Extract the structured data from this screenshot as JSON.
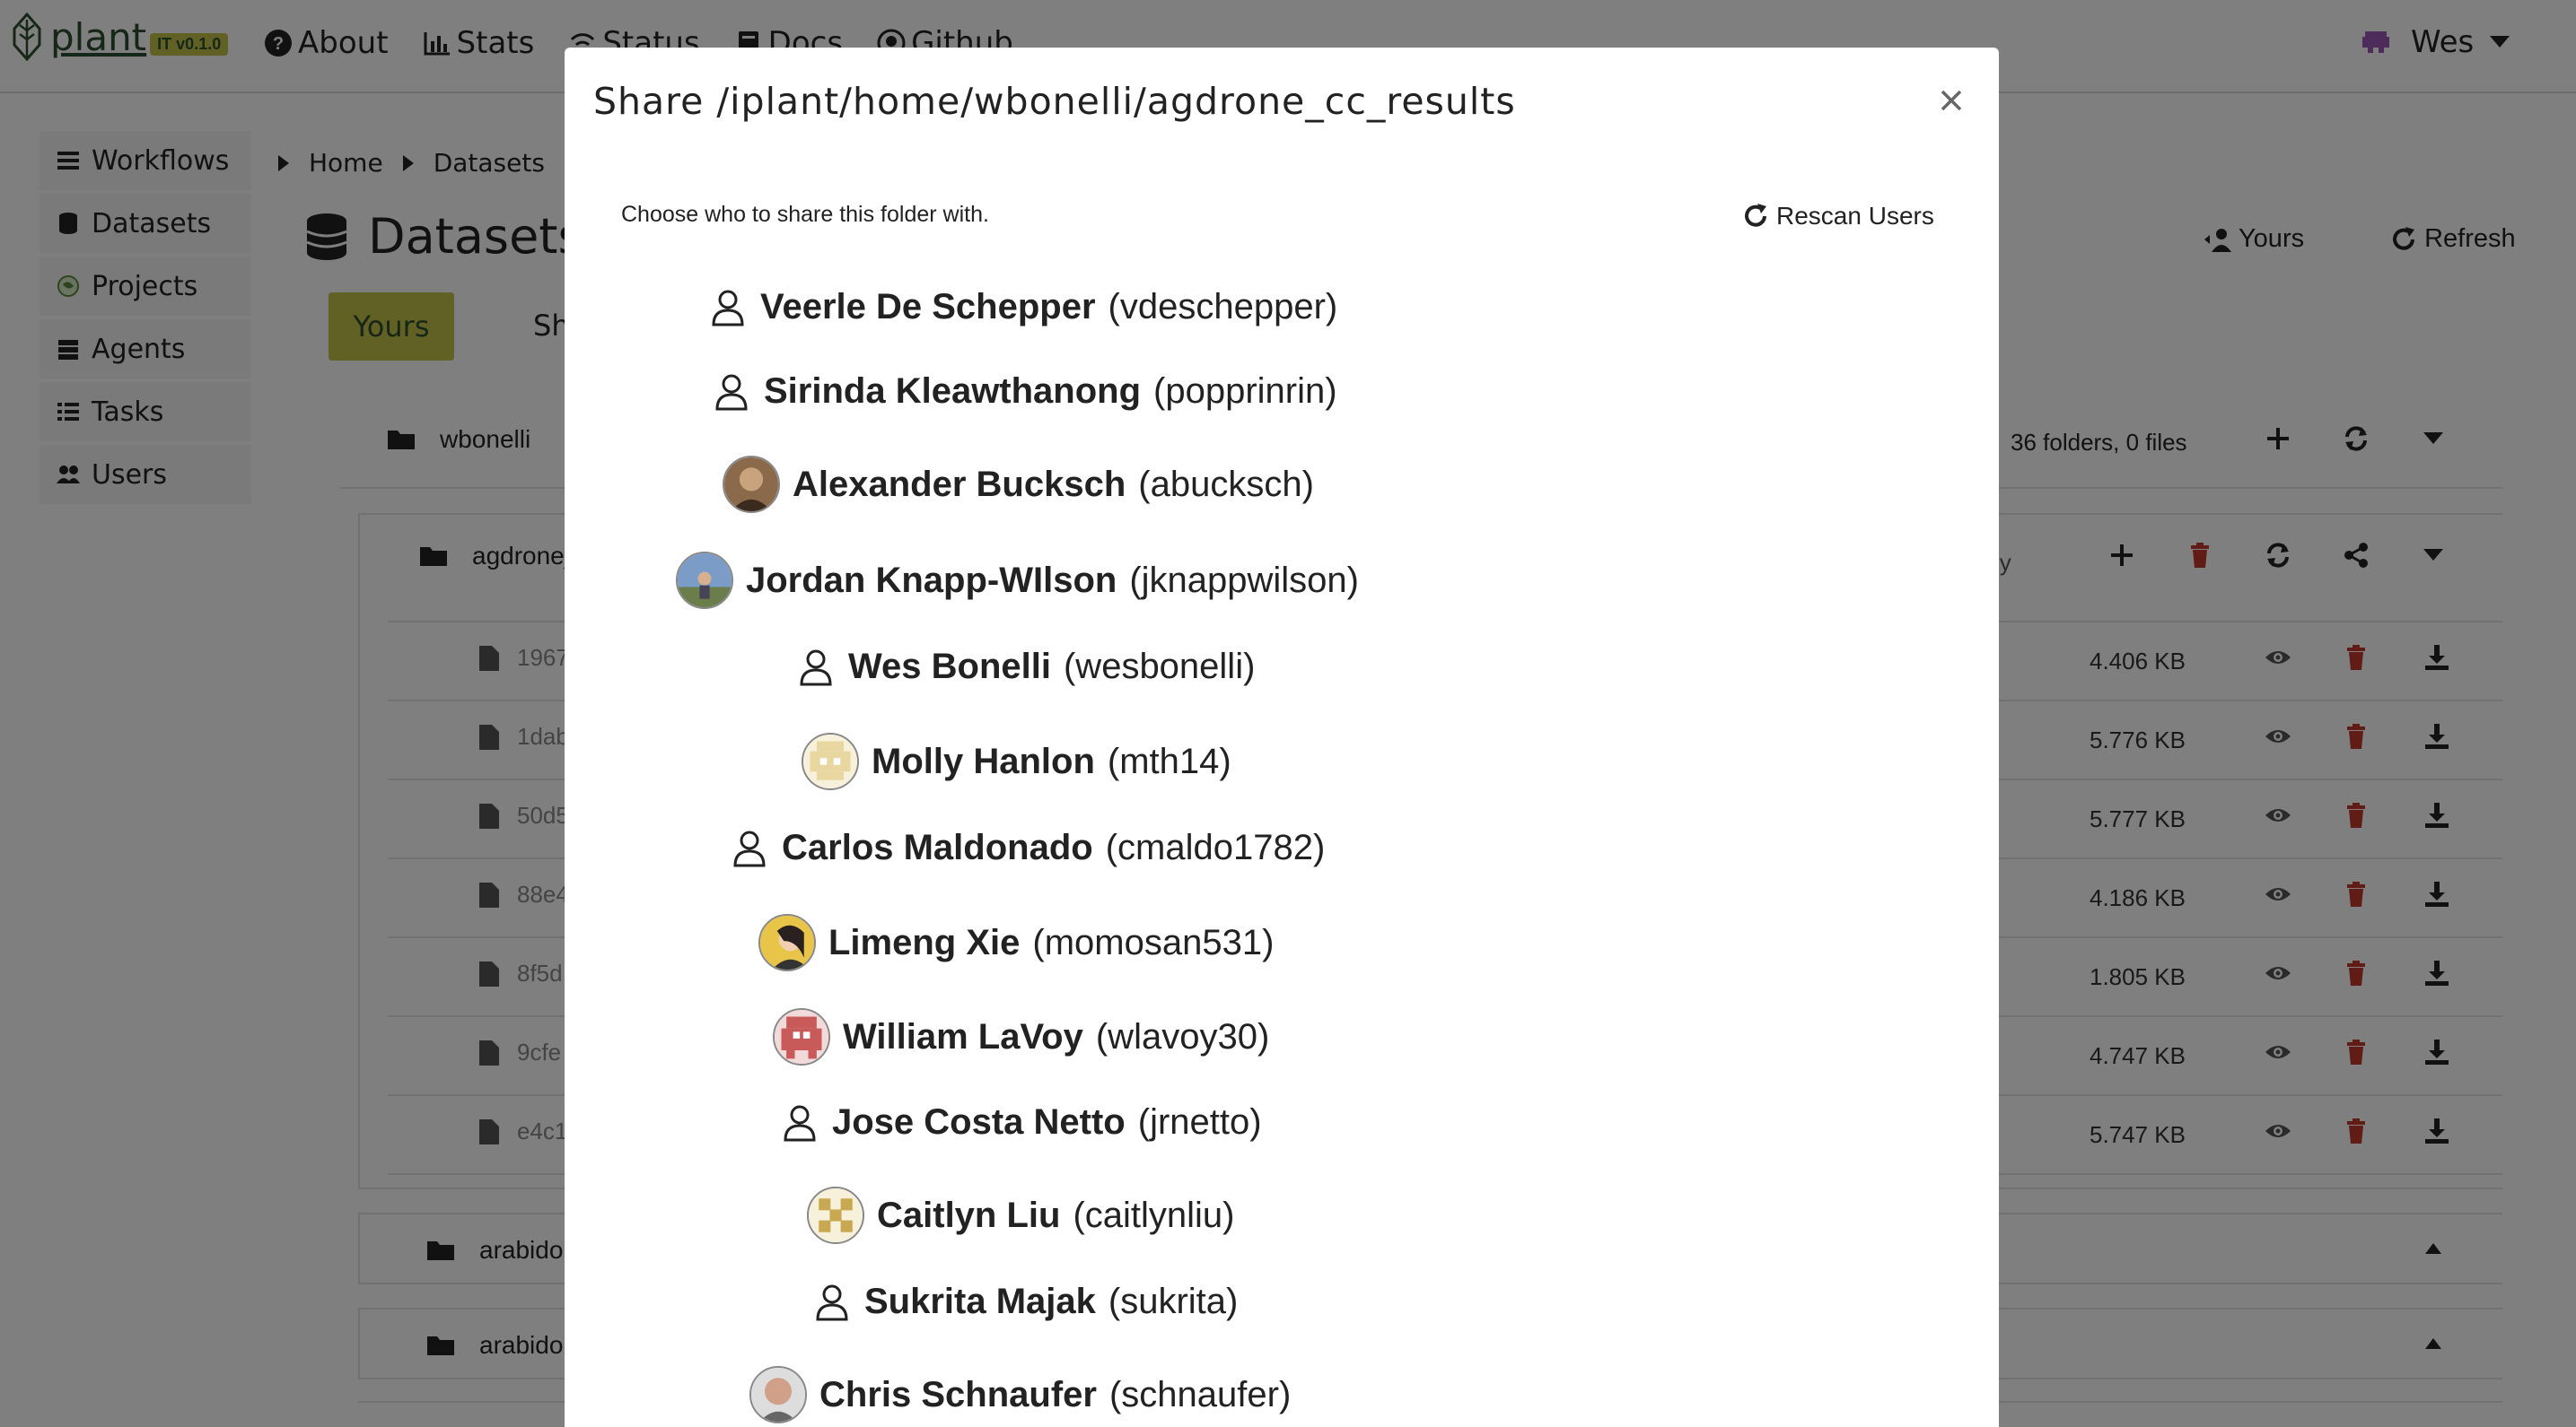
{
  "brand": {
    "name": "plant",
    "suffix": "IT",
    "version": "v0.1.0"
  },
  "nav": {
    "links": [
      "About",
      "Stats",
      "Status",
      "Docs",
      "Github"
    ],
    "user": "Wes"
  },
  "sidebar": {
    "items": [
      {
        "label": "Workflows",
        "icon": "list-icon"
      },
      {
        "label": "Datasets",
        "icon": "database-icon"
      },
      {
        "label": "Projects",
        "icon": "globe-icon"
      },
      {
        "label": "Agents",
        "icon": "server-icon"
      },
      {
        "label": "Tasks",
        "icon": "tasks-icon"
      },
      {
        "label": "Users",
        "icon": "users-icon"
      }
    ]
  },
  "breadcrumb": [
    "Home",
    "Datasets"
  ],
  "page": {
    "title": "Datasets",
    "tab_yours": "Yours",
    "tab_shared": "Sh",
    "yours_button": "Yours",
    "refresh_button": "Refresh"
  },
  "tree": {
    "root": "wbonelli",
    "summary": "36 folders, 0 files",
    "subfolder": "agdrone_",
    "subfolder_note": "ly",
    "files": [
      {
        "name": "1967",
        "size": "4.406 KB"
      },
      {
        "name": "1dab",
        "size": "5.776 KB"
      },
      {
        "name": "50d5",
        "size": "5.777 KB"
      },
      {
        "name": "88e4",
        "size": "4.186 KB"
      },
      {
        "name": "8f5d",
        "size": "1.805 KB"
      },
      {
        "name": "9cfe",
        "size": "4.747 KB"
      },
      {
        "name": "e4c1",
        "size": "5.747 KB"
      }
    ],
    "more_folders": [
      "arabidop",
      "arabidop"
    ]
  },
  "modal": {
    "title": "Share /iplant/home/wbonelli/agdrone_cc_results",
    "hint": "Choose who to share this folder with.",
    "rescan_label": "Rescan Users",
    "users": [
      {
        "name": "Veerle De Schepper",
        "handle": "(vdeschepper)",
        "avatar": "person-outline"
      },
      {
        "name": "Sirinda Kleawthanong",
        "handle": "(popprinrin)",
        "avatar": "person-outline"
      },
      {
        "name": "Alexander Bucksch",
        "handle": "(abucksch)",
        "avatar": "photo"
      },
      {
        "name": "Jordan Knapp-WIlson",
        "handle": "(jknappwilson)",
        "avatar": "photo"
      },
      {
        "name": "Wes Bonelli",
        "handle": "(wesbonelli)",
        "avatar": "person-outline"
      },
      {
        "name": "Molly Hanlon",
        "handle": "(mth14)",
        "avatar": "identicon"
      },
      {
        "name": "Carlos Maldonado",
        "handle": "(cmaldo1782)",
        "avatar": "person-outline"
      },
      {
        "name": "Limeng Xie",
        "handle": "(momosan531)",
        "avatar": "photo"
      },
      {
        "name": "William LaVoy",
        "handle": "(wlavoy30)",
        "avatar": "identicon"
      },
      {
        "name": "Jose Costa Netto",
        "handle": "(jrnetto)",
        "avatar": "person-outline"
      },
      {
        "name": "Caitlyn Liu",
        "handle": "(caitlynliu)",
        "avatar": "identicon"
      },
      {
        "name": "Sukrita Majak",
        "handle": "(sukrita)",
        "avatar": "person-outline"
      },
      {
        "name": "Chris Schnaufer",
        "handle": "(schnaufer)",
        "avatar": "photo"
      }
    ]
  },
  "colors": {
    "accent": "#c2c24a",
    "brand_text": "#2f4f2f",
    "danger": "#c0392b",
    "overlay": "rgba(0,0,0,0.5)"
  }
}
